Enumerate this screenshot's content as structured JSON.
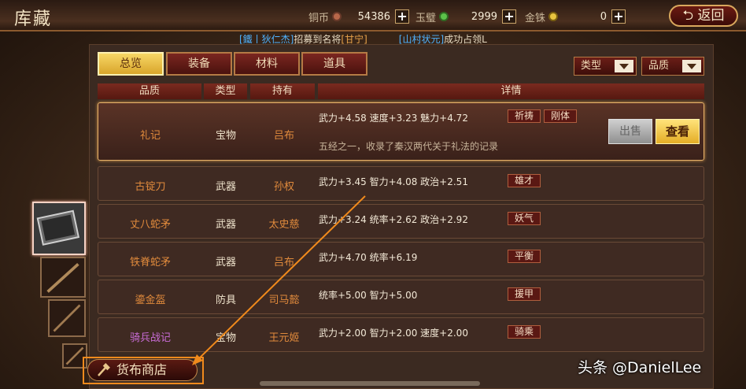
{
  "header": {
    "title": "库藏",
    "back_label": "返回",
    "back_icon": "return-arrow-icon",
    "currencies": [
      {
        "label": "铜币",
        "amount": "54386",
        "color": "#b8684a"
      },
      {
        "label": "玉璧",
        "amount": "2999",
        "color": "#5cc24a"
      },
      {
        "label": "金铢",
        "amount": "0",
        "color": "#e8c440"
      }
    ]
  },
  "notice": {
    "part1": "[鐵丨狄仁杰]",
    "part2": "招募到名将",
    "part3": "[甘宁]",
    "part4": "[山村状元]",
    "part5": "成功占领L"
  },
  "tabs": [
    "总览",
    "装备",
    "材料",
    "道具"
  ],
  "filters": [
    "类型",
    "品质"
  ],
  "columns": [
    "品质",
    "类型",
    "持有",
    "详情"
  ],
  "items": [
    {
      "name": "礼记",
      "type": "宝物",
      "holder": "吕布",
      "stats": "武力+4.58  速度+3.23  魅力+4.72",
      "tags": [
        "祈祷",
        "刚体"
      ],
      "desc": "五经之一，收录了秦汉两代关于礼法的记录"
    },
    {
      "name": "古锭刀",
      "type": "武器",
      "holder": "孙权",
      "stats": "武力+3.45  智力+4.08  政治+2.51",
      "tags": [
        "雄才"
      ]
    },
    {
      "name": "丈八蛇矛",
      "type": "武器",
      "holder": "太史慈",
      "stats": "武力+3.24  统率+2.62  政治+2.92",
      "tags": [
        "妖气"
      ]
    },
    {
      "name": "铁脊蛇矛",
      "type": "武器",
      "holder": "吕布",
      "stats": "武力+4.70  统率+6.19",
      "tags": [
        "平衡"
      ]
    },
    {
      "name": "鎏金盔",
      "type": "防具",
      "holder": "司马懿",
      "stats": "统率+5.00  智力+5.00",
      "tags": [
        "援甲"
      ]
    },
    {
      "name": "骑兵战记",
      "type": "宝物",
      "holder": "王元姬",
      "stats": "武力+2.00  智力+2.00  速度+2.00",
      "tags": [
        "骑乘"
      ]
    }
  ],
  "actions": {
    "sell": "出售",
    "view": "查看"
  },
  "shop": {
    "label": "货布商店",
    "icon": "hammer-icon"
  },
  "watermark": "头条 @DanielLee",
  "colors": {
    "accent": "#e4ad26",
    "highlight": "#f08a1c"
  }
}
